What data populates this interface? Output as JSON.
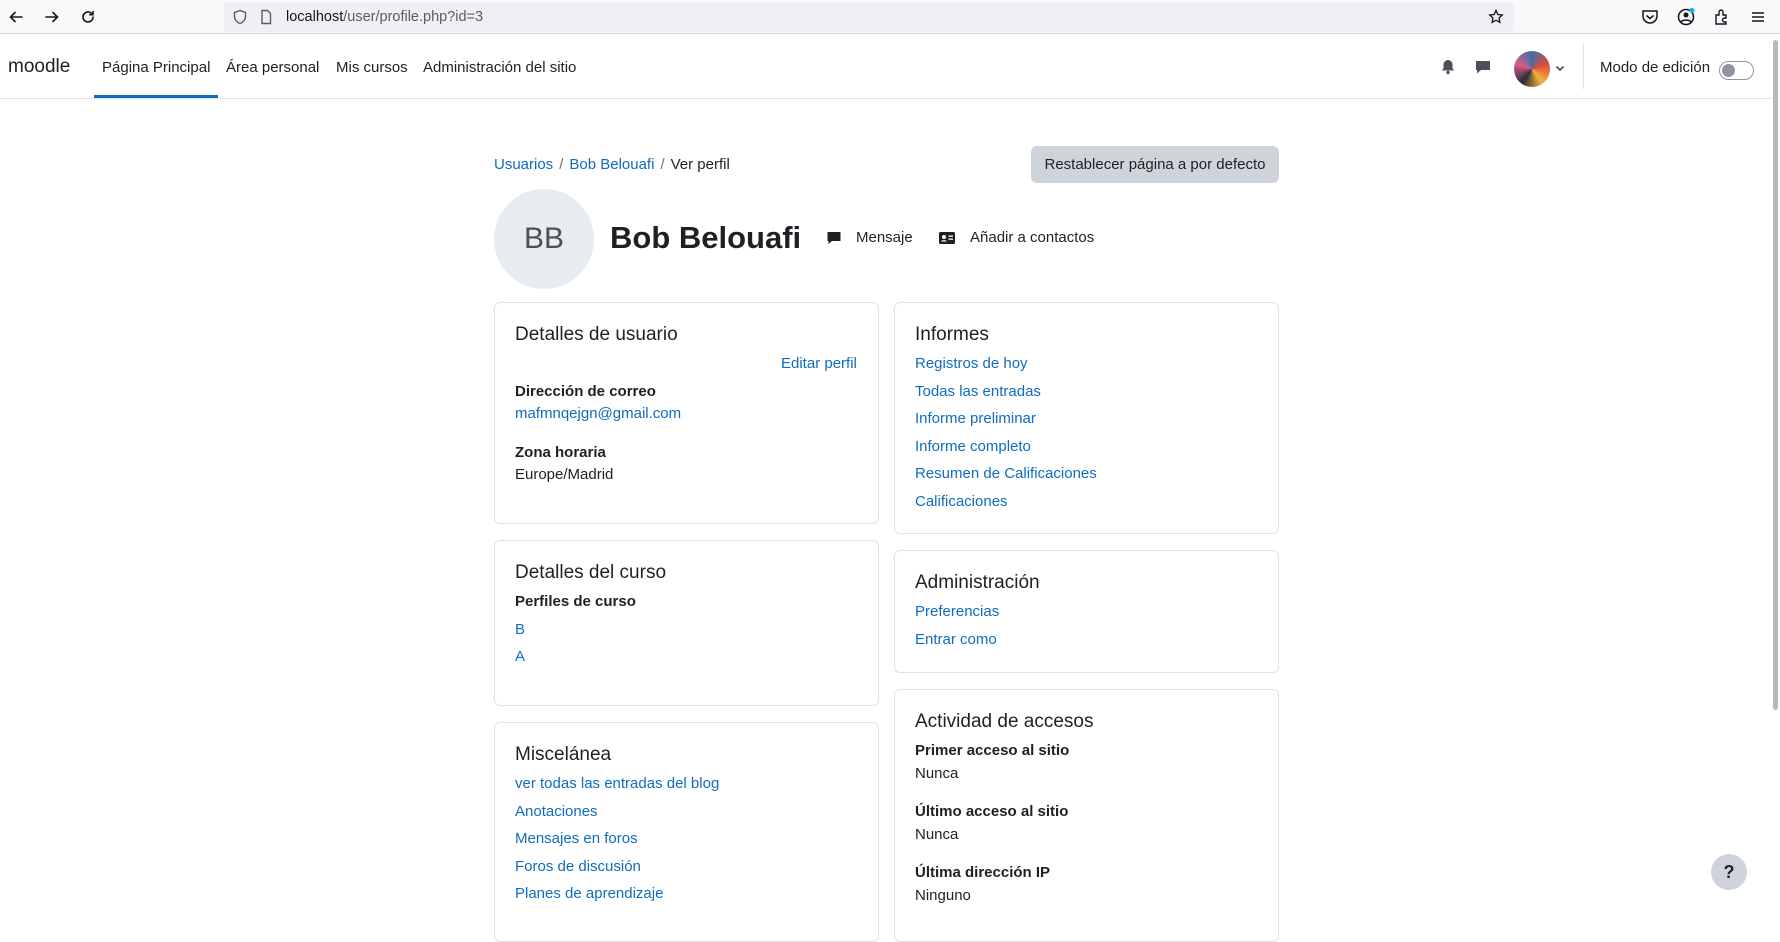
{
  "browser": {
    "url_host": "localhost",
    "url_path": "/user/profile.php?id=3"
  },
  "navbar": {
    "brand": "moodle",
    "items": [
      {
        "label": "Página Principal"
      },
      {
        "label": "Área personal"
      },
      {
        "label": "Mis cursos"
      },
      {
        "label": "Administración del sitio"
      }
    ],
    "edit_mode_label": "Modo de edición",
    "edit_mode_on": false
  },
  "breadcrumb": {
    "items": [
      "Usuarios",
      "Bob Belouafi",
      "Ver perfil"
    ]
  },
  "reset_button": "Restablecer página a por defecto",
  "profile": {
    "initials": "BB",
    "fullname": "Bob Belouafi",
    "message_label": "Mensaje",
    "add_contact_label": "Añadir a contactos"
  },
  "user_details": {
    "title": "Detalles de usuario",
    "edit_link": "Editar perfil",
    "email_label": "Dirección de correo",
    "email_value": "mafmnqejgn@gmail.com",
    "timezone_label": "Zona horaria",
    "timezone_value": "Europe/Madrid"
  },
  "course_details": {
    "title": "Detalles del curso",
    "profiles_label": "Perfiles de curso",
    "courses": [
      "B",
      "A"
    ]
  },
  "misc": {
    "title": "Miscelánea",
    "links": [
      "ver todas las entradas del blog",
      "Anotaciones",
      "Mensajes en foros",
      "Foros de discusión",
      "Planes de aprendizaje"
    ]
  },
  "reports": {
    "title": "Informes",
    "links": [
      "Registros de hoy",
      "Todas las entradas",
      "Informe preliminar",
      "Informe completo",
      "Resumen de Calificaciones",
      "Calificaciones"
    ]
  },
  "administration": {
    "title": "Administración",
    "links": [
      "Preferencias",
      "Entrar como"
    ]
  },
  "access": {
    "title": "Actividad de accesos",
    "first_access_label": "Primer acceso al sitio",
    "first_access_value": "Nunca",
    "last_access_label": "Último acceso al sitio",
    "last_access_value": "Nunca",
    "last_ip_label": "Última dirección IP",
    "last_ip_value": "Ninguno"
  },
  "help_button": "?"
}
